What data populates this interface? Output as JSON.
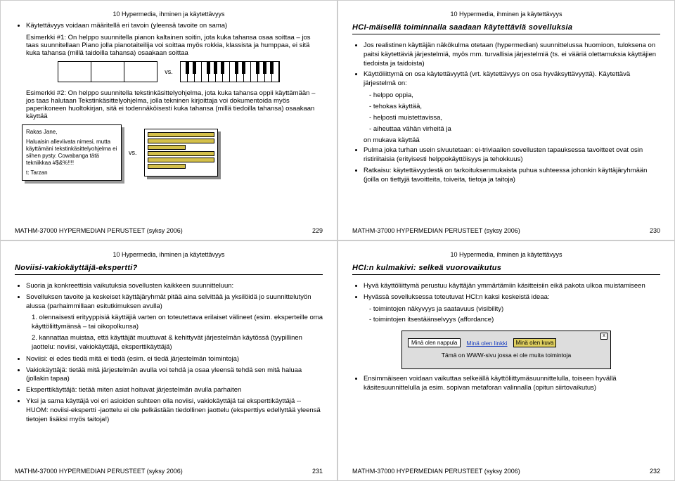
{
  "header": "10 Hypermedia, ihminen ja käytettävyys",
  "footer": "MATHM-37000 HYPERMEDIAN PERUSTEET (syksy 2006)",
  "pages": {
    "p229": "229",
    "p230": "230",
    "p231": "231",
    "p232": "232"
  },
  "vs": "vs.",
  "s229": {
    "b1": "Käytettävyys voidaan määritellä eri tavoin (yleensä tavoite on sama)",
    "e1": "Esimerkki #1: On helppo suunnitella pianon kaltainen soitin, jota kuka tahansa osaa soittaa – jos taas suunnitellaan Piano jolla pianotaiteilija voi soittaa myös rokkia, klassista ja humppaa, ei sitä kuka tahansa (millä taidoilla tahansa) osaakaan soittaa",
    "e2": "Esimerkki #2: On helppo suunnitella tekstinkäsittelyohjelma, jota kuka tahansa oppii käyttämään – jos taas halutaan Tekstinkäsittelyohjelma, jolla tekninen kirjoittaja voi dokumentoida myös paperikoneen huoltokirjan, sitä ei todennäköisesti kuka tahansa (millä tiedoilla tahansa) osaakaan käyttää",
    "note": {
      "l1": "Rakas Jane,",
      "l2": "Haluaisin alleviivata nimesi, mutta käyttämäni tekstinkäsittelyohjelma ei siihen pysty. Cowabanga tätä tekniikkaa #$&%!!!!",
      "l3": "t: Tarzan"
    }
  },
  "s230": {
    "title": "HCI-mäisellä toiminnalla saadaan käytettäviä sovelluksia",
    "b1": "Jos realistinen käyttäjän näkökulma otetaan (hypermedian) suunnittelussa huomioon, tuloksena on paitsi käytettäviä järjestelmiä, myös mm. turvallisia järjestelmiä (ts. ei vääriä olettamuksia käyttäjien tiedoista ja taidoista)",
    "b2": "Käyttöliittymä on osa käytettävyyttä (vrt. käytettävyys on osa hyväksyttävyyttä). Käytettävä järjestelmä on:",
    "sub": [
      "helppo oppia,",
      "tehokas käyttää,",
      "helposti muistettavissa,",
      "aiheuttaa vähän virheitä ja"
    ],
    "b3": "on mukava käyttää",
    "b4": "Pulma joka turhan usein sivuutetaan: ei-triviaalien sovellusten tapauksessa tavoitteet ovat osin ristiriitaisia (erityisesti helppokäyttöisyys ja tehokkuus)",
    "b5": "Ratkaisu: käytettävyydestä on tarkoituksenmukaista puhua suhteessa johonkin käyttäjäryhmään (joilla on tiettyjä tavoitteita, toiveita, tietoja ja taitoja)"
  },
  "s231": {
    "title": "Noviisi-vakiokäyttäjä-ekspertti?",
    "b1": "Suoria ja konkreettisia vaikutuksia sovellusten kaikkeen suunnitteluun:",
    "b2": "Sovelluksen tavoite ja keskeiset käyttäjäryhmät pitää aina selvittää ja yksilöidä jo suunnittelutyön alussa (parhaimmillaan esitutkimuksen avulla)",
    "n1": "1. olennaisesti erityyppisiä käyttäjiä varten on toteutettava erilaiset välineet (esim. eksperteille oma käyttöliittymänsä – tai oikopolkunsa)",
    "n2": "2. kannattaa muistaa, että käyttäjät muuttuvat & kehittyvät järjestelmän käytössä (tyypillinen jaottelu: noviisi, vakiokäyttäjä, eksperttikäyttäjä)",
    "b3": "Noviisi: ei edes tiedä mitä ei tiedä (esim. ei tiedä järjestelmän toimintoja)",
    "b4": "Vakiokäyttäjä: tietää mitä järjestelmän avulla voi tehdä ja osaa yleensä tehdä sen mitä haluaa (jollakin tapaa)",
    "b5": "Eksperttikäyttäjä: tietää miten asiat hoituvat järjestelmän avulla parhaiten",
    "b6": "Yksi ja sama käyttäjä voi eri asioiden suhteen olla noviisi, vakiokäyttäjä tai eksperttikäyttäjä -- HUOM: noviisi-ekspertti -jaottelu ei ole pelkästään tiedollinen jaottelu (eksperttiys edellyttää yleensä tietojen lisäksi myös taitoja!)"
  },
  "s232": {
    "title": "HCI:n kulmakivi: selkeä vuorovaikutus",
    "b1": "Hyvä käyttöliittymä perustuu käyttäjän ymmärtämiin käsitteisiin eikä pakota ulkoa muistamiseen",
    "b2": "Hyvässä sovelluksessa toteutuvat HCI:n kaksi keskeistä ideaa:",
    "s1": "toimintojen näkyvyys ja saatavuus (visibility)",
    "s2": "toimintojen itsestäänselvyys (affordance)",
    "demo": {
      "btn": "Minä olen nappula",
      "link": "Minä olen linkki",
      "img": "Minä olen kuva",
      "caption": "Tämä on WWW-sivu jossa ei ole muita toimintoja"
    },
    "b3": "Ensimmäiseen voidaan vaikuttaa selkeällä käyttöliittymäsuunnittelulla, toiseen hyvällä käsitesuunnittelulla ja esim. sopivan metaforan valinnalla (opitun siirtovaikutus)"
  }
}
